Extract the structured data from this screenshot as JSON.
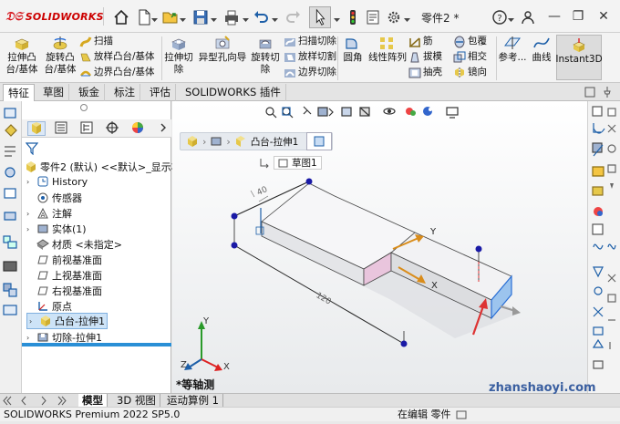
{
  "app": {
    "logo_text": "SOLIDWORKS",
    "document_title": "零件2 *"
  },
  "ribbon": {
    "extrude_boss": "拉伸凸\n台/基体",
    "revolve_boss": "旋转凸\n台/基体",
    "sweep": "扫描",
    "loft_boss": "放样凸台/基体",
    "boundary_boss": "边界凸台/基体",
    "extrude_cut": "拉伸切\n除",
    "hole_wizard": "异型孔向导",
    "revolve_cut": "旋转切\n除",
    "sweep_cut": "扫描切除",
    "loft_cut": "放样切割",
    "boundary_cut": "边界切除",
    "fillet": "圆角",
    "linear_pattern": "线性阵列",
    "rib": "筋",
    "draft": "拔模",
    "shell": "抽壳",
    "wrap": "包覆",
    "intersect": "相交",
    "mirror": "镜向",
    "reference": "参考...",
    "curves": "曲线",
    "instant3d": "Instant3D"
  },
  "tabs": [
    "特征",
    "草图",
    "钣金",
    "标注",
    "评估",
    "SOLIDWORKS 插件"
  ],
  "tree": {
    "root": "零件2 (默认) <<默认>_显示状",
    "items": [
      "History",
      "传感器",
      "注解",
      "实体(1)",
      "材质 <未指定>",
      "前视基准面",
      "上视基准面",
      "右视基准面",
      "原点",
      "凸台-拉伸1",
      "切除-拉伸1"
    ]
  },
  "viewport": {
    "breadcrumb": "凸台-拉伸1",
    "flyout": "草图1",
    "view_name": "*等轴测",
    "dim_a": "40",
    "dim_b": "120",
    "axis_x": "X",
    "axis_y": "Y",
    "triad_x": "X",
    "triad_y": "Y",
    "triad_z": "Z"
  },
  "bottom_tabs": [
    "模型",
    "3D 视图",
    "运动算例 1"
  ],
  "status": {
    "left": "SOLIDWORKS Premium 2022 SP5.0",
    "mode": "在编辑 零件",
    "watermark": "zhanshaoyi.com"
  }
}
